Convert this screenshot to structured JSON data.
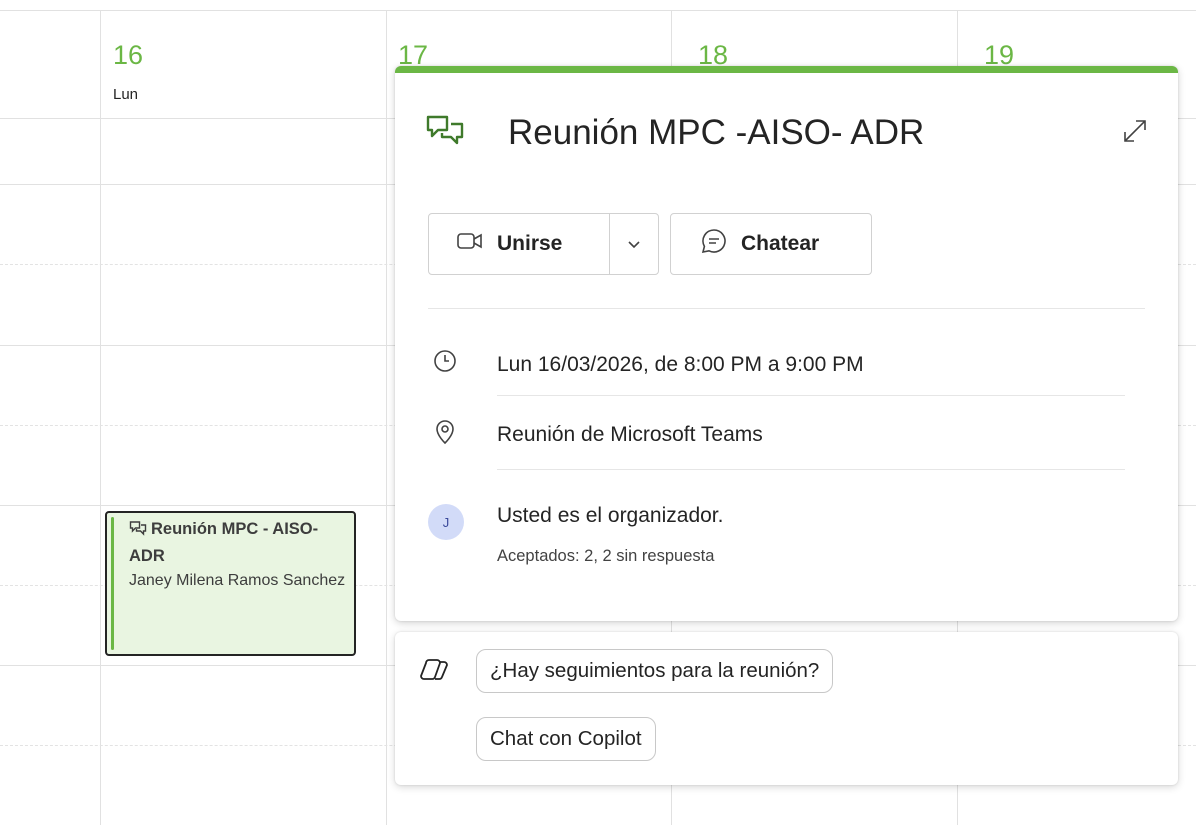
{
  "calendar": {
    "days": [
      {
        "number": "16",
        "name": "Lun"
      },
      {
        "number": "17",
        "name": ""
      },
      {
        "number": "18",
        "name": ""
      },
      {
        "number": "19",
        "name": ""
      }
    ],
    "accent_color": "#6bb745"
  },
  "event_card": {
    "title": "Reunión MPC - AISO- ADR",
    "organizer": "Janey Milena Ramos Sanchez"
  },
  "popup": {
    "title": "Reunión MPC -AISO- ADR",
    "title_icon": "teams-chat-icon",
    "join_label": "Unirse",
    "chat_label": "Chatear",
    "datetime": "Lun 16/03/2026, de 8:00 PM a 9:00 PM",
    "location": "Reunión de Microsoft Teams",
    "avatar_initial": "J",
    "organizer_text": "Usted es el organizador.",
    "responses": "Aceptados: 2, 2 sin respuesta"
  },
  "copilot": {
    "suggestion_1": "¿Hay seguimientos para la reunión?",
    "suggestion_2": "Chat con Copilot"
  }
}
